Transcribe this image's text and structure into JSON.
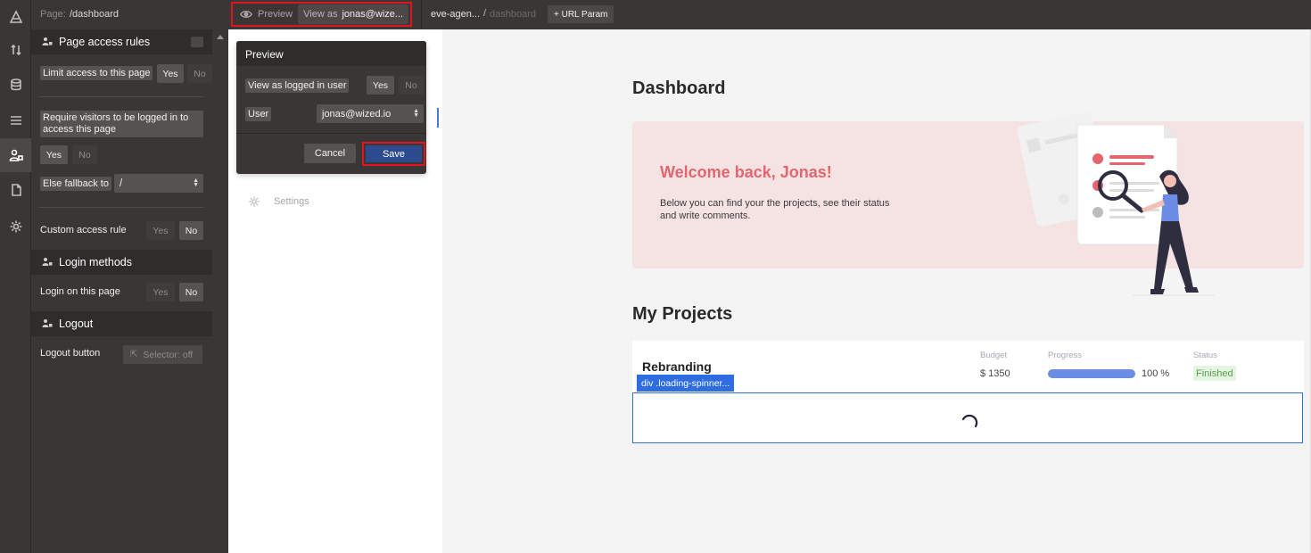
{
  "topbar": {
    "page_label": "Page:",
    "page_path": "/dashboard",
    "preview_label": "Preview",
    "view_as_label": "View as",
    "view_as_value": "jonas@wize...",
    "project_name": "eve-agen...",
    "slash": "/",
    "route": "dashboard",
    "url_param_label": "+ URL Param"
  },
  "rail": {
    "icons": [
      "logo-icon",
      "arrows-updown-icon",
      "database-icon",
      "list-icon",
      "user-lock-icon",
      "file-icon",
      "gear-icon"
    ]
  },
  "panel": {
    "page_access": {
      "title": "Page access rules",
      "limit_label": "Limit access to this page",
      "limit_yes": "Yes",
      "limit_no": "No",
      "require_label": "Require visitors to be logged in to access this page",
      "require_yes": "Yes",
      "require_no": "No",
      "fallback_label": "Else fallback to",
      "fallback_value": "/",
      "custom_label": "Custom access rule",
      "custom_yes": "Yes",
      "custom_no": "No"
    },
    "login_methods": {
      "title": "Login methods",
      "login_label": "Login on this page",
      "login_yes": "Yes",
      "login_no": "No"
    },
    "logout": {
      "title": "Logout",
      "button_label": "Logout button",
      "selector_value": "Selector: off"
    }
  },
  "popup": {
    "title": "Preview",
    "view_logged_label": "View as logged in user",
    "yes": "Yes",
    "no": "No",
    "user_label": "User",
    "user_value": "jonas@wized.io",
    "cancel_label": "Cancel",
    "save_label": "Save"
  },
  "midcol": {
    "settings_label": "Settings"
  },
  "canvas": {
    "dashboard_title": "Dashboard",
    "welcome_title": "Welcome back, Jonas!",
    "welcome_desc": "Below you can find your the projects, see their status and write comments.",
    "projects_title": "My Projects",
    "project": {
      "name": "Rebranding",
      "budget_header": "Budget",
      "progress_header": "Progress",
      "status_header": "Status",
      "budget": "$ 1350",
      "progress_pct": "100 %",
      "progress_value": 1.0,
      "status": "Finished"
    },
    "spinner_label": "div  .loading-spinner..."
  },
  "colors": {
    "accent_red": "#e0141e",
    "save_blue": "#2c4b8f",
    "welcome_text": "#e5656e",
    "progress_blue": "#6b8de3",
    "selection_blue": "#2d6de0"
  }
}
